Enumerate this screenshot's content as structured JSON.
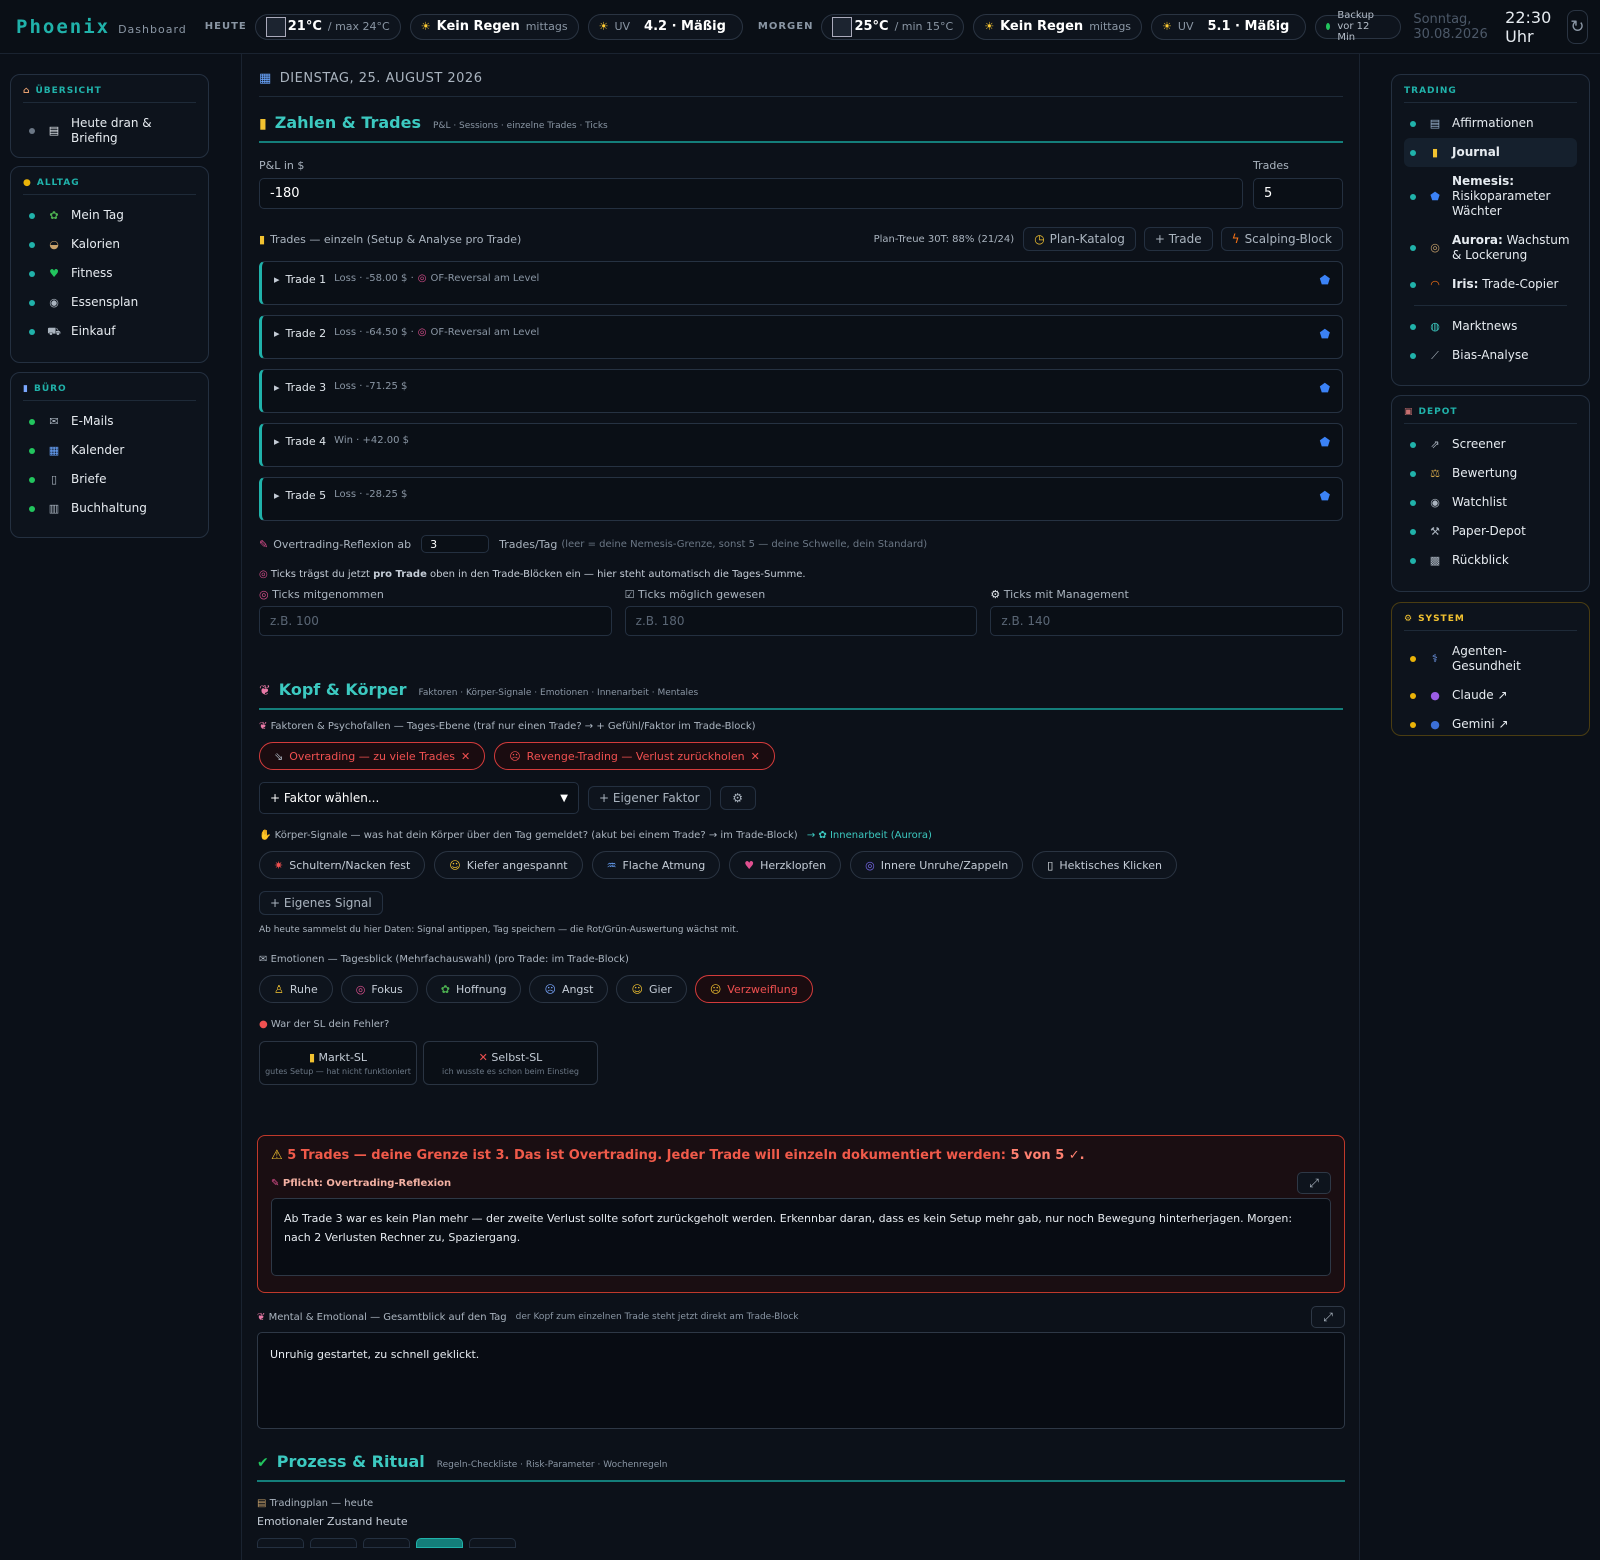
{
  "topbar": {
    "logo": "Phoenix",
    "logo_sub": "Dashboard",
    "today_label": "HEUTE",
    "today_temp": "21°C",
    "today_temp_sub": "/ max 24°C",
    "today_rain": "Kein Regen",
    "today_rain_sub": "mittags",
    "uv_label": "UV",
    "today_uv": "4.2 · Mäßig",
    "tomorrow_label": "MORGEN",
    "tomorrow_temp": "25°C",
    "tomorrow_temp_sub": "/ min 15°C",
    "tomorrow_rain": "Kein Regen",
    "tomorrow_rain_sub": "mittags",
    "tomorrow_uv": "5.1 · Mäßig",
    "backup": "Backup vor 12 Min",
    "date": "Sonntag, 30.08.2026",
    "time": "22:30 Uhr",
    "refresh_icon": "↻"
  },
  "left_sidebar": {
    "overview": {
      "title": "ÜBERSICHT",
      "items": [
        {
          "label": "Heute dran & Briefing"
        }
      ]
    },
    "alltag": {
      "title": "ALLTAG",
      "items": [
        {
          "label": "Mein Tag"
        },
        {
          "label": "Kalorien"
        },
        {
          "label": "Fitness"
        },
        {
          "label": "Essensplan"
        },
        {
          "label": "Einkauf"
        }
      ]
    },
    "buero": {
      "title": "BÜRO",
      "items": [
        {
          "label": "E-Mails"
        },
        {
          "label": "Kalender"
        },
        {
          "label": "Briefe"
        },
        {
          "label": "Buchhaltung"
        }
      ]
    }
  },
  "right_sidebar": {
    "trading": {
      "title": "TRADING",
      "items": [
        {
          "label": "Affirmationen"
        },
        {
          "label": "Journal"
        },
        {
          "bold": "Nemesis:",
          "label": "Risikoparameter Wächter"
        },
        {
          "bold": "Aurora:",
          "label": "Wachstum & Lockerung"
        },
        {
          "bold": "Iris:",
          "label": "Trade-Copier"
        },
        {
          "label": "Marktnews"
        },
        {
          "label": "Bias-Analyse"
        }
      ]
    },
    "depot": {
      "title": "DEPOT",
      "items": [
        {
          "label": "Screener"
        },
        {
          "label": "Bewertung"
        },
        {
          "label": "Watchlist"
        },
        {
          "label": "Paper-Depot"
        },
        {
          "label": "Rückblick"
        }
      ]
    },
    "system": {
      "title": "SYSTEM",
      "items": [
        {
          "label": "Agenten-Gesundheit"
        },
        {
          "label": "Claude ↗"
        },
        {
          "label": "Gemini ↗"
        }
      ]
    }
  },
  "main": {
    "date_heading": "DIENSTAG, 25. AUGUST 2026",
    "zahlen": {
      "title": "Zahlen & Trades",
      "subtitle": "P&L · Sessions · einzelne Trades · Ticks",
      "pnl_label": "P&L in $",
      "pnl_value": "-180",
      "trades_label": "Trades",
      "trades_value": "5",
      "trades_list_label": "Trades — einzeln (Setup & Analyse pro Trade)",
      "plan_treue": "Plan-Treue 30T: 88% (21/24)",
      "btn_plan_katalog": "Plan-Katalog",
      "btn_trade": "+ Trade",
      "btn_scalping": "Scalping-Block",
      "trades": [
        {
          "name": "Trade 1",
          "info": "Loss · -58.00 $ ·",
          "setup": "OF-Reversal am Level"
        },
        {
          "name": "Trade 2",
          "info": "Loss · -64.50 $ ·",
          "setup": "OF-Reversal am Level"
        },
        {
          "name": "Trade 3",
          "info": "Loss · -71.25 $",
          "setup": ""
        },
        {
          "name": "Trade 4",
          "info": "Win · +42.00 $",
          "setup": ""
        },
        {
          "name": "Trade 5",
          "info": "Loss · -28.25 $",
          "setup": ""
        }
      ],
      "overtrading_label": "Overtrading-Reflexion ab",
      "overtrading_value": "3",
      "overtrading_suffix": "Trades/Tag",
      "overtrading_hint": "(leer = deine Nemesis-Grenze, sonst 5 — deine Schwelle, dein Standard)",
      "ticks_note_pre": "Ticks trägst du jetzt ",
      "ticks_note_bold": "pro Trade",
      "ticks_note_post": " oben in den Trade-Blöcken ein — hier steht automatisch die Tages-Summe.",
      "ticks_taken_label": "Ticks mitgenommen",
      "ticks_taken_ph": "z.B. 100",
      "ticks_possible_label": "Ticks möglich gewesen",
      "ticks_possible_ph": "z.B. 180",
      "ticks_mgmt_label": "Ticks mit Management",
      "ticks_mgmt_ph": "z.B. 140"
    },
    "kopf": {
      "title": "Kopf & Körper",
      "subtitle": "Faktoren · Körper-Signale · Emotionen · Innenarbeit · Mentales",
      "faktoren_label": "Faktoren & Psychofallen — Tages-Ebene (traf nur einen Trade? → + Gefühl/Faktor im Trade-Block)",
      "faktoren_selected": [
        "Overtrading — zu viele Trades",
        "Revenge-Trading — Verlust zurückholen"
      ],
      "faktor_select": "+ Faktor wählen...",
      "eigener_faktor": "+ Eigener Faktor",
      "koerper_label": "Körper-Signale — was hat dein Körper über den Tag gemeldet? (akut bei einem Trade? → im Trade-Block)",
      "koerper_link": "Innenarbeit (Aurora)",
      "signals": [
        "Schultern/Nacken fest",
        "Kiefer angespannt",
        "Flache Atmung",
        "Herzklopfen",
        "Innere Unruhe/Zappeln",
        "Hektisches Klicken"
      ],
      "eigenes_signal": "+ Eigenes Signal",
      "signal_note": "Ab heute sammelst du hier Daten: Signal antippen, Tag speichern — die Rot/Grün-Auswertung wächst mit.",
      "emotionen_label": "Emotionen — Tagesblick (Mehrfachauswahl) (pro Trade: im Trade-Block)",
      "emotions": [
        "Ruhe",
        "Fokus",
        "Hoffnung",
        "Angst",
        "Gier",
        "Verzweiflung"
      ],
      "sl_label": "War der SL dein Fehler?",
      "sl_markt": "Markt-SL",
      "sl_markt_sub": "gutes Setup — hat nicht funktioniert",
      "sl_selbst": "Selbst-SL",
      "sl_selbst_sub": "ich wusste es schon beim Einstieg",
      "alert_title_pre": "5 Trades — deine Grenze ist 3. Das ist Overtrading. Jeder Trade will einzeln dokumentiert werden: ",
      "alert_title_bold": "5 von 5 ✓.",
      "alert_sub": "Pflicht: Overtrading-Reflexion",
      "alert_text": "Ab Trade 3 war es kein Plan mehr — der zweite Verlust sollte sofort zurückgeholt werden. Erkennbar daran, dass es kein Setup mehr gab, nur noch Bewegung hinterherjagen. Morgen: nach 2 Verlusten Rechner zu, Spaziergang.",
      "mental_label": "Mental & Emotional — Gesamtblick auf den Tag",
      "mental_hint": "der Kopf zum einzelnen Trade steht jetzt direkt am Trade-Block",
      "mental_text": "Unruhig gestartet, zu schnell geklickt."
    },
    "prozess": {
      "title": "Prozess & Ritual",
      "subtitle": "Regeln-Checkliste · Risk-Parameter · Wochenregeln",
      "plan_label": "Tradingplan — heute",
      "state_label": "Emotionaler Zustand heute"
    }
  },
  "colors": {
    "accent": "#20b2aa",
    "danger": "#f05050",
    "background": "#0b1018",
    "system": "#f2c230"
  }
}
